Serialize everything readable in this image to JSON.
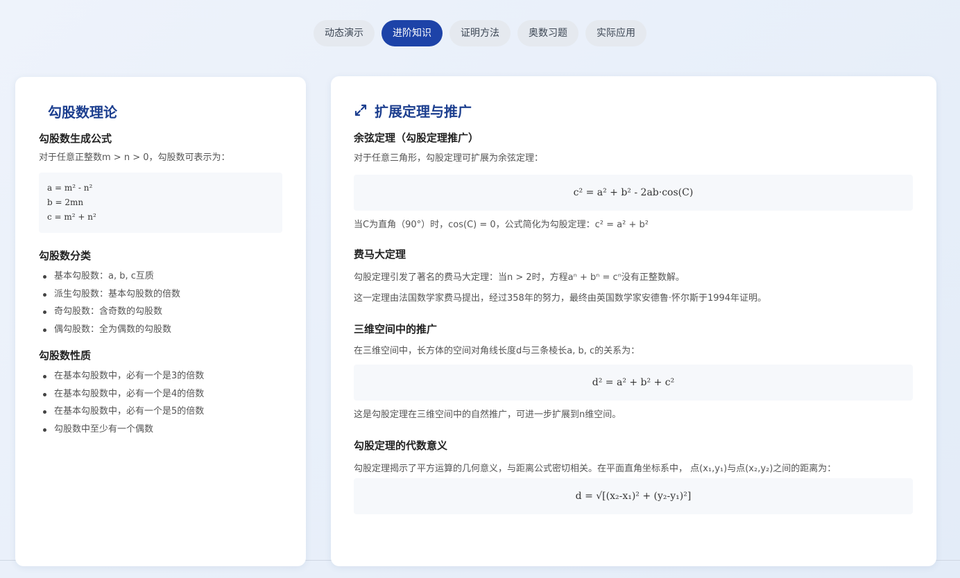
{
  "tabs": [
    {
      "label": "动态演示",
      "active": false
    },
    {
      "label": "进阶知识",
      "active": true
    },
    {
      "label": "证明方法",
      "active": false
    },
    {
      "label": "奥数习题",
      "active": false
    },
    {
      "label": "实际应用",
      "active": false
    }
  ],
  "left": {
    "title": "勾股数理论",
    "gen": {
      "heading": "勾股数生成公式",
      "intro": "对于任意正整数m > n > 0，勾股数可表示为：",
      "lines": [
        "a = m² - n²",
        "b = 2mn",
        "c = m² + n²"
      ]
    },
    "classify": {
      "heading": "勾股数分类",
      "items": [
        "基本勾股数：a, b, c互质",
        "派生勾股数：基本勾股数的倍数",
        "奇勾股数：含奇数的勾股数",
        "偶勾股数：全为偶数的勾股数"
      ]
    },
    "props": {
      "heading": "勾股数性质",
      "items": [
        "在基本勾股数中，必有一个是3的倍数",
        "在基本勾股数中，必有一个是4的倍数",
        "在基本勾股数中，必有一个是5的倍数",
        "勾股数中至少有一个偶数"
      ]
    }
  },
  "right": {
    "icon": "expand-arrows-icon",
    "title": "扩展定理与推广",
    "cosine": {
      "heading": "余弦定理（勾股定理推广）",
      "intro": "对于任意三角形，勾股定理可扩展为余弦定理：",
      "formula": "c² = a² + b² - 2ab·cos(C)",
      "note": "当C为直角（90°）时，cos(C) = 0，公式简化为勾股定理：c² = a² + b²"
    },
    "fermat": {
      "heading": "费马大定理",
      "line1": "勾股定理引发了著名的费马大定理：当n > 2时，方程aⁿ + bⁿ = cⁿ没有正整数解。",
      "line2": "这一定理由法国数学家费马提出，经过358年的努力，最终由英国数学家安德鲁·怀尔斯于1994年证明。"
    },
    "space3d": {
      "heading": "三维空间中的推广",
      "intro": "在三维空间中，长方体的空间对角线长度d与三条棱长a, b, c的关系为：",
      "formula": "d² = a² + b² + c²",
      "note": "这是勾股定理在三维空间中的自然推广，可进一步扩展到n维空间。"
    },
    "algebra": {
      "heading": "勾股定理的代数意义",
      "intro": "勾股定理揭示了平方运算的几何意义，与距离公式密切相关。在平面直角坐标系中， 点(x₁,y₁)与点(x₂,y₂)之间的距离为：",
      "formula": "d = √[(x₂-x₁)² + (y₂-y₁)²]"
    }
  },
  "colors": {
    "accent": "#1d43a8",
    "title": "#1d3f8f"
  }
}
